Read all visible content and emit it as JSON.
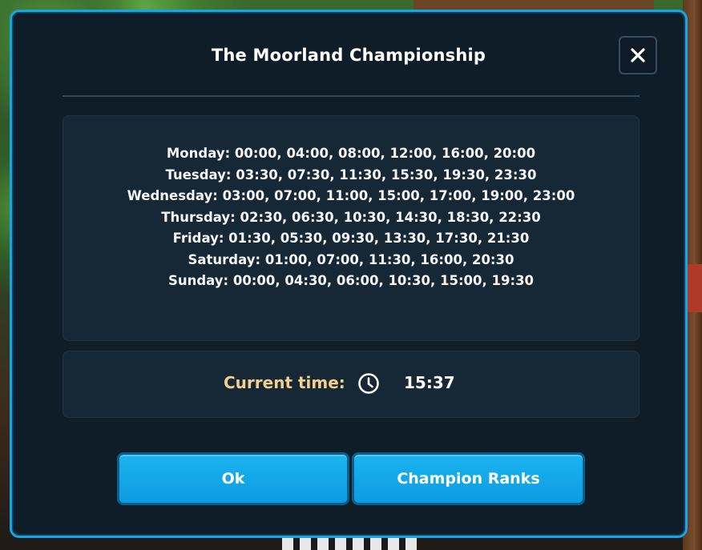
{
  "dialog": {
    "title": "The Moorland Championship",
    "close_icon": "close-icon",
    "schedule": [
      "Monday: 00:00, 04:00, 08:00, 12:00, 16:00, 20:00",
      "Tuesday: 03:30, 07:30, 11:30, 15:30, 19:30, 23:30",
      "Wednesday: 03:00, 07:00, 11:00, 15:00, 17:00, 19:00, 23:00",
      "Thursday: 02:30, 06:30, 10:30, 14:30, 18:30, 22:30",
      "Friday: 01:30, 05:30, 09:30, 13:30, 17:30, 21:30",
      "Saturday: 01:00, 07:00, 11:30, 16:00, 20:30",
      "Sunday: 00:00, 04:30, 06:00, 10:30, 15:00, 19:30"
    ],
    "current_time_label": "Current time:",
    "clock_icon": "clock-icon",
    "current_time_value": "15:37",
    "buttons": {
      "ok_label": "Ok",
      "ranks_label": "Champion Ranks"
    }
  },
  "colors": {
    "accent": "#16a6e6",
    "panel": "#162735",
    "dialog_bg": "#0f1d29",
    "time_label": "#f2cf8a"
  }
}
